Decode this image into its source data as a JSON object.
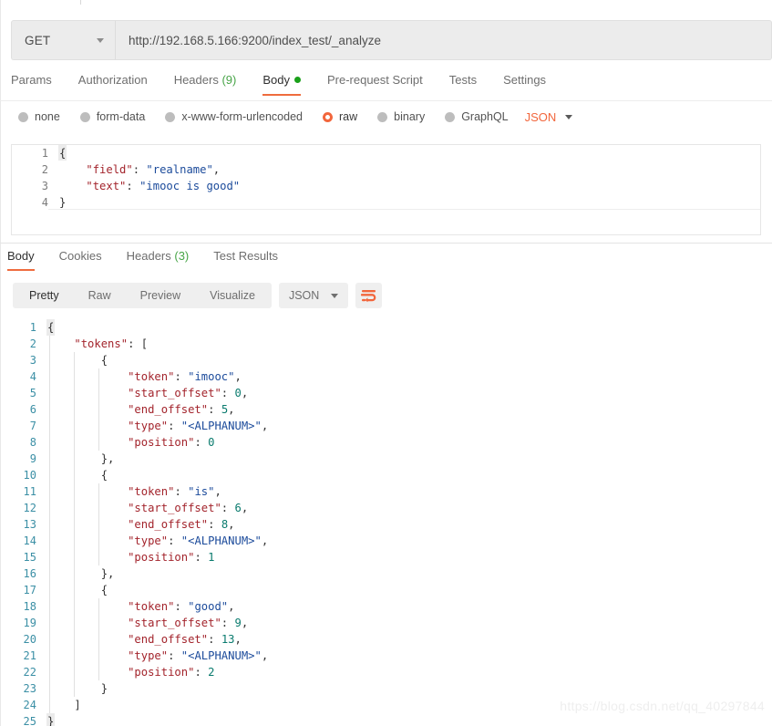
{
  "request": {
    "method": "GET",
    "url": "http://192.168.5.166:9200/index_test/_analyze",
    "tabs": [
      {
        "label": "Params",
        "active": false
      },
      {
        "label": "Authorization",
        "active": false
      },
      {
        "label": "Headers",
        "count": "(9)",
        "active": false
      },
      {
        "label": "Body",
        "active": true,
        "dot": true
      },
      {
        "label": "Pre-request Script",
        "active": false
      },
      {
        "label": "Tests",
        "active": false
      },
      {
        "label": "Settings",
        "active": false
      }
    ],
    "body_types": [
      {
        "label": "none",
        "selected": false
      },
      {
        "label": "form-data",
        "selected": false
      },
      {
        "label": "x-www-form-urlencoded",
        "selected": false
      },
      {
        "label": "raw",
        "selected": true
      },
      {
        "label": "binary",
        "selected": false
      },
      {
        "label": "GraphQL",
        "selected": false
      }
    ],
    "format": "JSON",
    "editor_lines": [
      {
        "n": "1",
        "cursor": true,
        "parts": [
          {
            "t": "punct",
            "s": "{"
          }
        ]
      },
      {
        "n": "2",
        "parts": [
          {
            "t": "plain",
            "s": "    "
          },
          {
            "t": "key",
            "s": "\"field\""
          },
          {
            "t": "punct",
            "s": ": "
          },
          {
            "t": "str",
            "s": "\"realname\""
          },
          {
            "t": "punct",
            "s": ","
          }
        ]
      },
      {
        "n": "3",
        "parts": [
          {
            "t": "plain",
            "s": "    "
          },
          {
            "t": "key",
            "s": "\"text\""
          },
          {
            "t": "punct",
            "s": ": "
          },
          {
            "t": "str",
            "s": "\"imooc is good\""
          }
        ]
      },
      {
        "n": "4",
        "parts": [
          {
            "t": "punct",
            "s": "}"
          }
        ]
      }
    ]
  },
  "response": {
    "tabs": [
      {
        "label": "Body",
        "active": true
      },
      {
        "label": "Cookies",
        "active": false
      },
      {
        "label": "Headers",
        "count": "(3)",
        "active": false
      },
      {
        "label": "Test Results",
        "active": false
      }
    ],
    "view_modes": [
      {
        "label": "Pretty",
        "active": true
      },
      {
        "label": "Raw",
        "active": false
      },
      {
        "label": "Preview",
        "active": false
      },
      {
        "label": "Visualize",
        "active": false
      }
    ],
    "format": "JSON",
    "wrap_icon": "word-wrap-icon",
    "body_lines": [
      {
        "n": "1",
        "guides": 0,
        "cursor": true,
        "parts": [
          {
            "t": "punct",
            "s": "{"
          }
        ]
      },
      {
        "n": "2",
        "guides": 1,
        "parts": [
          {
            "t": "plain",
            "s": "    "
          },
          {
            "t": "key",
            "s": "\"tokens\""
          },
          {
            "t": "punct",
            "s": ": ["
          }
        ]
      },
      {
        "n": "3",
        "guides": 2,
        "parts": [
          {
            "t": "plain",
            "s": "        "
          },
          {
            "t": "punct",
            "s": "{"
          }
        ]
      },
      {
        "n": "4",
        "guides": 3,
        "parts": [
          {
            "t": "plain",
            "s": "            "
          },
          {
            "t": "key",
            "s": "\"token\""
          },
          {
            "t": "punct",
            "s": ": "
          },
          {
            "t": "str",
            "s": "\"imooc\""
          },
          {
            "t": "punct",
            "s": ","
          }
        ]
      },
      {
        "n": "5",
        "guides": 3,
        "parts": [
          {
            "t": "plain",
            "s": "            "
          },
          {
            "t": "key",
            "s": "\"start_offset\""
          },
          {
            "t": "punct",
            "s": ": "
          },
          {
            "t": "num",
            "s": "0"
          },
          {
            "t": "punct",
            "s": ","
          }
        ]
      },
      {
        "n": "6",
        "guides": 3,
        "parts": [
          {
            "t": "plain",
            "s": "            "
          },
          {
            "t": "key",
            "s": "\"end_offset\""
          },
          {
            "t": "punct",
            "s": ": "
          },
          {
            "t": "num",
            "s": "5"
          },
          {
            "t": "punct",
            "s": ","
          }
        ]
      },
      {
        "n": "7",
        "guides": 3,
        "parts": [
          {
            "t": "plain",
            "s": "            "
          },
          {
            "t": "key",
            "s": "\"type\""
          },
          {
            "t": "punct",
            "s": ": "
          },
          {
            "t": "str",
            "s": "\"<ALPHANUM>\""
          },
          {
            "t": "punct",
            "s": ","
          }
        ]
      },
      {
        "n": "8",
        "guides": 3,
        "parts": [
          {
            "t": "plain",
            "s": "            "
          },
          {
            "t": "key",
            "s": "\"position\""
          },
          {
            "t": "punct",
            "s": ": "
          },
          {
            "t": "num",
            "s": "0"
          }
        ]
      },
      {
        "n": "9",
        "guides": 2,
        "parts": [
          {
            "t": "plain",
            "s": "        "
          },
          {
            "t": "punct",
            "s": "},"
          }
        ]
      },
      {
        "n": "10",
        "guides": 2,
        "parts": [
          {
            "t": "plain",
            "s": "        "
          },
          {
            "t": "punct",
            "s": "{"
          }
        ]
      },
      {
        "n": "11",
        "guides": 3,
        "parts": [
          {
            "t": "plain",
            "s": "            "
          },
          {
            "t": "key",
            "s": "\"token\""
          },
          {
            "t": "punct",
            "s": ": "
          },
          {
            "t": "str",
            "s": "\"is\""
          },
          {
            "t": "punct",
            "s": ","
          }
        ]
      },
      {
        "n": "12",
        "guides": 3,
        "parts": [
          {
            "t": "plain",
            "s": "            "
          },
          {
            "t": "key",
            "s": "\"start_offset\""
          },
          {
            "t": "punct",
            "s": ": "
          },
          {
            "t": "num",
            "s": "6"
          },
          {
            "t": "punct",
            "s": ","
          }
        ]
      },
      {
        "n": "13",
        "guides": 3,
        "parts": [
          {
            "t": "plain",
            "s": "            "
          },
          {
            "t": "key",
            "s": "\"end_offset\""
          },
          {
            "t": "punct",
            "s": ": "
          },
          {
            "t": "num",
            "s": "8"
          },
          {
            "t": "punct",
            "s": ","
          }
        ]
      },
      {
        "n": "14",
        "guides": 3,
        "parts": [
          {
            "t": "plain",
            "s": "            "
          },
          {
            "t": "key",
            "s": "\"type\""
          },
          {
            "t": "punct",
            "s": ": "
          },
          {
            "t": "str",
            "s": "\"<ALPHANUM>\""
          },
          {
            "t": "punct",
            "s": ","
          }
        ]
      },
      {
        "n": "15",
        "guides": 3,
        "parts": [
          {
            "t": "plain",
            "s": "            "
          },
          {
            "t": "key",
            "s": "\"position\""
          },
          {
            "t": "punct",
            "s": ": "
          },
          {
            "t": "num",
            "s": "1"
          }
        ]
      },
      {
        "n": "16",
        "guides": 2,
        "parts": [
          {
            "t": "plain",
            "s": "        "
          },
          {
            "t": "punct",
            "s": "},"
          }
        ]
      },
      {
        "n": "17",
        "guides": 2,
        "parts": [
          {
            "t": "plain",
            "s": "        "
          },
          {
            "t": "punct",
            "s": "{"
          }
        ]
      },
      {
        "n": "18",
        "guides": 3,
        "parts": [
          {
            "t": "plain",
            "s": "            "
          },
          {
            "t": "key",
            "s": "\"token\""
          },
          {
            "t": "punct",
            "s": ": "
          },
          {
            "t": "str",
            "s": "\"good\""
          },
          {
            "t": "punct",
            "s": ","
          }
        ]
      },
      {
        "n": "19",
        "guides": 3,
        "parts": [
          {
            "t": "plain",
            "s": "            "
          },
          {
            "t": "key",
            "s": "\"start_offset\""
          },
          {
            "t": "punct",
            "s": ": "
          },
          {
            "t": "num",
            "s": "9"
          },
          {
            "t": "punct",
            "s": ","
          }
        ]
      },
      {
        "n": "20",
        "guides": 3,
        "parts": [
          {
            "t": "plain",
            "s": "            "
          },
          {
            "t": "key",
            "s": "\"end_offset\""
          },
          {
            "t": "punct",
            "s": ": "
          },
          {
            "t": "num",
            "s": "13"
          },
          {
            "t": "punct",
            "s": ","
          }
        ]
      },
      {
        "n": "21",
        "guides": 3,
        "parts": [
          {
            "t": "plain",
            "s": "            "
          },
          {
            "t": "key",
            "s": "\"type\""
          },
          {
            "t": "punct",
            "s": ": "
          },
          {
            "t": "str",
            "s": "\"<ALPHANUM>\""
          },
          {
            "t": "punct",
            "s": ","
          }
        ]
      },
      {
        "n": "22",
        "guides": 3,
        "parts": [
          {
            "t": "plain",
            "s": "            "
          },
          {
            "t": "key",
            "s": "\"position\""
          },
          {
            "t": "punct",
            "s": ": "
          },
          {
            "t": "num",
            "s": "2"
          }
        ]
      },
      {
        "n": "23",
        "guides": 2,
        "parts": [
          {
            "t": "plain",
            "s": "        "
          },
          {
            "t": "punct",
            "s": "}"
          }
        ]
      },
      {
        "n": "24",
        "guides": 1,
        "parts": [
          {
            "t": "plain",
            "s": "    "
          },
          {
            "t": "punct",
            "s": "]"
          }
        ]
      },
      {
        "n": "25",
        "guides": 0,
        "cursor": true,
        "parts": [
          {
            "t": "punct",
            "s": "}"
          }
        ]
      }
    ]
  },
  "watermark": "https://blog.csdn.net/qq_40297844",
  "colors": {
    "accent": "#ef6c3e",
    "accent_text": "#f2663c",
    "green": "#47a447",
    "key": "#a3242c",
    "string": "#1c4b9b",
    "number": "#0a7b6e",
    "linenum": "#3b8fa5"
  }
}
